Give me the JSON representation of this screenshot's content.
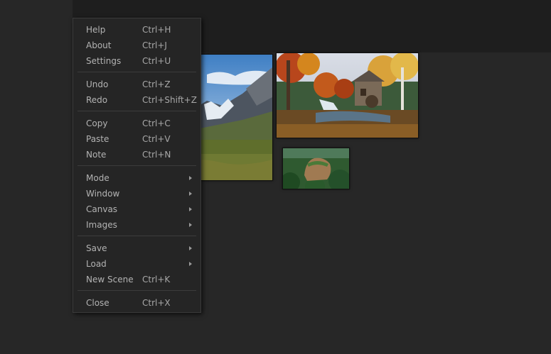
{
  "menu": {
    "help": {
      "label": "Help",
      "shortcut": "Ctrl+H"
    },
    "about": {
      "label": "About",
      "shortcut": "Ctrl+J"
    },
    "settings": {
      "label": "Settings",
      "shortcut": "Ctrl+U"
    },
    "undo": {
      "label": "Undo",
      "shortcut": "Ctrl+Z"
    },
    "redo": {
      "label": "Redo",
      "shortcut": "Ctrl+Shift+Z"
    },
    "copy": {
      "label": "Copy",
      "shortcut": "Ctrl+C"
    },
    "paste": {
      "label": "Paste",
      "shortcut": "Ctrl+V"
    },
    "note": {
      "label": "Note",
      "shortcut": "Ctrl+N"
    },
    "mode": {
      "label": "Mode"
    },
    "window": {
      "label": "Window"
    },
    "canvas": {
      "label": "Canvas"
    },
    "images": {
      "label": "Images"
    },
    "save": {
      "label": "Save"
    },
    "load": {
      "label": "Load"
    },
    "new_scene": {
      "label": "New Scene",
      "shortcut": "Ctrl+K"
    },
    "close": {
      "label": "Close",
      "shortcut": "Ctrl+X"
    }
  },
  "colors": {
    "background": "#222222",
    "menu_background": "#252525",
    "menu_text": "#b3b3b3"
  }
}
